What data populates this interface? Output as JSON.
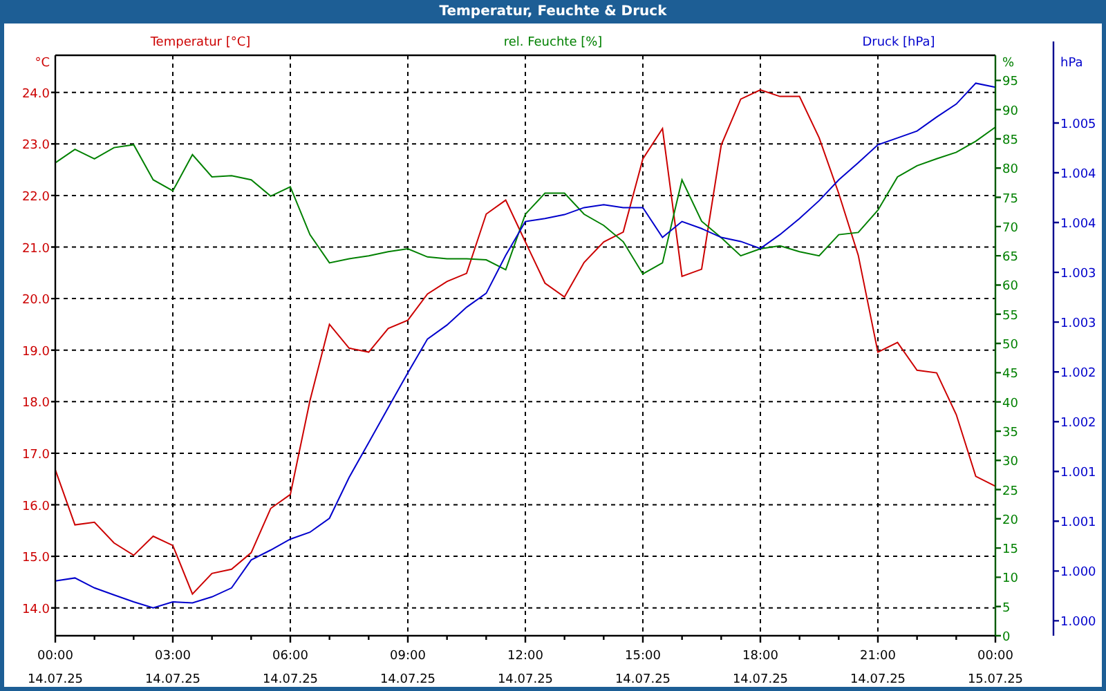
{
  "window": {
    "title": "Temperatur, Feuchte & Druck"
  },
  "chart": {
    "chart_data": {
      "type": "line",
      "categories": [
        "00:00\n14.07.25",
        null,
        null,
        null,
        null,
        null,
        "03:00\n14.07.25",
        null,
        null,
        null,
        null,
        null,
        "06:00\n14.07.25",
        null,
        null,
        null,
        null,
        null,
        "09:00\n14.07.25",
        null,
        null,
        null,
        null,
        null,
        "12:00\n14.07.25",
        null,
        null,
        null,
        null,
        null,
        "15:00\n14.07.25",
        null,
        null,
        null,
        null,
        null,
        "18:00\n14.07.25",
        null,
        null,
        null,
        null,
        null,
        "21:00\n14.07.25",
        null,
        null,
        null,
        null,
        null,
        "00:00\n15.07.25"
      ],
      "grid": true,
      "ylabel": "°C",
      "ylim": [
        13.46,
        24.72
      ],
      "yticks": [
        {
          "value": 14,
          "label": "14.0"
        },
        {
          "value": 15,
          "label": "15.0"
        },
        {
          "value": 16,
          "label": "16.0"
        },
        {
          "value": 17,
          "label": "17.0"
        },
        {
          "value": 18,
          "label": "18.0"
        },
        {
          "value": 19,
          "label": "19.0"
        },
        {
          "value": 20,
          "label": "20.0"
        },
        {
          "value": 21,
          "label": "21.0"
        },
        {
          "value": 22,
          "label": "22.0"
        },
        {
          "value": 23,
          "label": "23.0"
        },
        {
          "value": 24,
          "label": "24.0"
        }
      ],
      "y2label": "%",
      "y2lim": [
        0,
        99.3
      ],
      "y2ticks": [
        0,
        5,
        10,
        15,
        20,
        25,
        30,
        35,
        40,
        45,
        50,
        55,
        60,
        65,
        70,
        75,
        80,
        85,
        90,
        95
      ],
      "y3label": "hPa",
      "y3lim": [
        0.99985,
        1.00568
      ],
      "y3ticks": [
        {
          "value": 1.0,
          "label": "1.000"
        },
        {
          "value": 1.0005,
          "label": "1.000"
        },
        {
          "value": 1.001,
          "label": "1.001"
        },
        {
          "value": 1.0015,
          "label": "1.001"
        },
        {
          "value": 1.002,
          "label": "1.002"
        },
        {
          "value": 1.0025,
          "label": "1.002"
        },
        {
          "value": 1.003,
          "label": "1.003"
        },
        {
          "value": 1.0035,
          "label": "1.003"
        },
        {
          "value": 1.004,
          "label": "1.004"
        },
        {
          "value": 1.0045,
          "label": "1.004"
        },
        {
          "value": 1.005,
          "label": "1.005"
        }
      ],
      "series": [
        {
          "name": "Temperatur [°C]",
          "color": "#cc0000",
          "values": [
            16.68,
            15.61,
            15.66,
            15.26,
            15.02,
            15.39,
            15.21,
            14.27,
            14.67,
            14.75,
            15.07,
            15.93,
            16.2,
            18.02,
            19.5,
            19.04,
            18.96,
            19.42,
            19.58,
            20.09,
            20.33,
            20.49,
            21.64,
            21.91,
            21.1,
            20.3,
            20.03,
            20.7,
            21.1,
            21.29,
            22.71,
            23.3,
            20.43,
            20.57,
            22.98,
            23.87,
            24.05,
            23.92,
            23.92,
            23.12,
            22.04,
            20.84,
            18.96,
            19.15,
            18.61,
            18.56,
            17.75,
            16.55,
            16.36
          ]
        },
        {
          "name": "rel. Feuchte [%]",
          "color": "#008000",
          "axis": "y2",
          "values": [
            80.9,
            83.2,
            81.6,
            83.5,
            84.0,
            78.0,
            76.1,
            82.3,
            78.5,
            78.7,
            78.0,
            75.2,
            76.8,
            68.6,
            63.8,
            64.5,
            65.0,
            65.7,
            66.2,
            64.8,
            64.5,
            64.5,
            64.3,
            62.6,
            72.1,
            75.7,
            75.7,
            72.1,
            70.2,
            67.4,
            61.9,
            63.8,
            78.0,
            70.9,
            68.1,
            65.0,
            66.2,
            66.7,
            65.7,
            65.0,
            68.6,
            69.0,
            72.8,
            78.5,
            80.4,
            81.6,
            82.7,
            84.6,
            87.0
          ]
        },
        {
          "name": "Druck [hPa]",
          "color": "#0000cc",
          "axis": "y3",
          "values": [
            1.0004,
            1.00043,
            1.00033,
            1.00026,
            1.00019,
            1.00013,
            1.00019,
            1.00018,
            1.00024,
            1.00033,
            1.00061,
            1.00071,
            1.00082,
            1.00089,
            1.00103,
            1.00144,
            1.00179,
            1.00214,
            1.00249,
            1.00283,
            1.00297,
            1.00315,
            1.00329,
            1.00367,
            1.00401,
            1.00404,
            1.00408,
            1.00415,
            1.00418,
            1.00415,
            1.00415,
            1.00385,
            1.00401,
            1.00394,
            1.00385,
            1.00381,
            1.00374,
            1.00388,
            1.00404,
            1.00422,
            1.00443,
            1.0046,
            1.00478,
            1.00485,
            1.00492,
            1.00506,
            1.00519,
            1.0054,
            1.00536
          ]
        }
      ]
    }
  }
}
